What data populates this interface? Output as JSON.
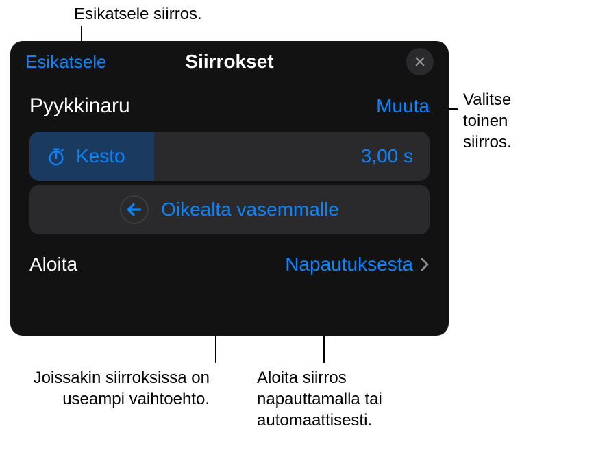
{
  "callouts": {
    "top": "Esikatsele siirros.",
    "right_line1": "Valitse",
    "right_line2": "toinen",
    "right_line3": "siirros.",
    "bottom_left_line1": "Joissakin siirroksissa on",
    "bottom_left_line2": "useampi vaihtoehto.",
    "bottom_right_line1": "Aloita siirros",
    "bottom_right_line2": "napauttamalla tai",
    "bottom_right_line3": "automaattisesti."
  },
  "header": {
    "preview": "Esikatsele",
    "title": "Siirrokset"
  },
  "transition": {
    "name": "Pyykkinaru",
    "change": "Muuta"
  },
  "duration": {
    "label": "Kesto",
    "value": "3,00 s"
  },
  "direction": {
    "label": "Oikealta vasemmalle"
  },
  "start": {
    "label": "Aloita",
    "value": "Napautuksesta"
  },
  "colors": {
    "accent": "#0a84ff"
  }
}
